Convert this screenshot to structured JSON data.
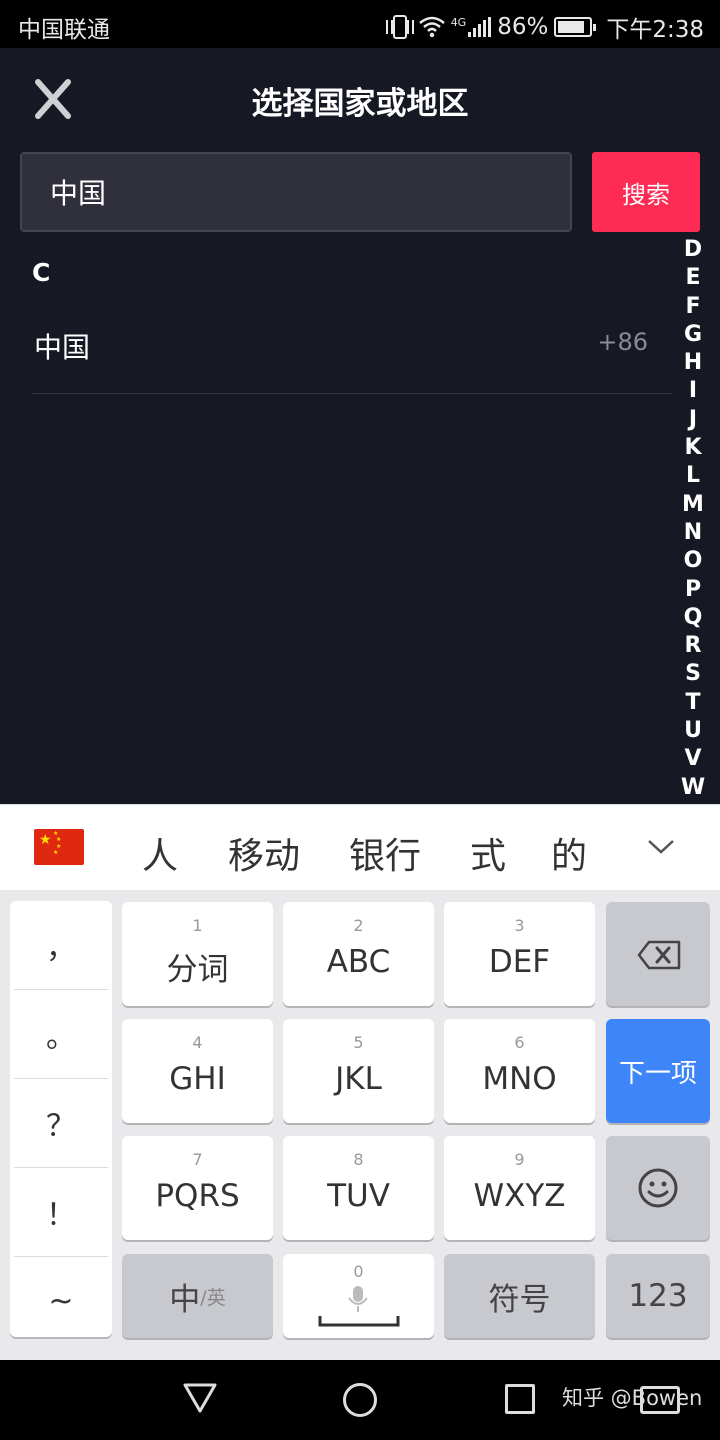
{
  "status_bar": {
    "carrier": "中国联通",
    "network": "4G",
    "battery_percent": "86%",
    "battery_level": 0.86,
    "time": "下午2:38"
  },
  "header": {
    "title": "选择国家或地区",
    "close_icon": "close-icon"
  },
  "search": {
    "value": "中国",
    "button_label": "搜索"
  },
  "results": {
    "section_letter": "C",
    "items": [
      {
        "name": "中国",
        "code": "+86"
      }
    ]
  },
  "alphabet_index": [
    "D",
    "E",
    "F",
    "G",
    "H",
    "I",
    "J",
    "K",
    "L",
    "M",
    "N",
    "O",
    "P",
    "Q",
    "R",
    "S",
    "T",
    "U",
    "V",
    "W"
  ],
  "ime": {
    "flag_icon": "china-flag-icon",
    "candidates": [
      "人",
      "移动",
      "银行",
      "式",
      "的"
    ],
    "collapse_icon": "chevron-down-icon",
    "punctuation": [
      "，",
      "。",
      "？",
      "！",
      "~"
    ],
    "keys": {
      "k1": {
        "num": "1",
        "label": "分词"
      },
      "k2": {
        "num": "2",
        "label": "ABC"
      },
      "k3": {
        "num": "3",
        "label": "DEF"
      },
      "k4": {
        "num": "4",
        "label": "GHI"
      },
      "k5": {
        "num": "5",
        "label": "JKL"
      },
      "k6": {
        "num": "6",
        "label": "MNO"
      },
      "k7": {
        "num": "7",
        "label": "PQRS"
      },
      "k8": {
        "num": "8",
        "label": "TUV"
      },
      "k9": {
        "num": "9",
        "label": "WXYZ"
      },
      "k0": {
        "num": "0"
      },
      "lang_main": "中",
      "lang_sub": "/英",
      "symbols": "符号",
      "numbers": "123",
      "next": "下一项"
    }
  },
  "nav_bar": {
    "watermark": "知乎 @Bowen"
  },
  "colors": {
    "background": "#161823",
    "accent": "#fe2c55",
    "ime_next": "#3d85f8"
  }
}
